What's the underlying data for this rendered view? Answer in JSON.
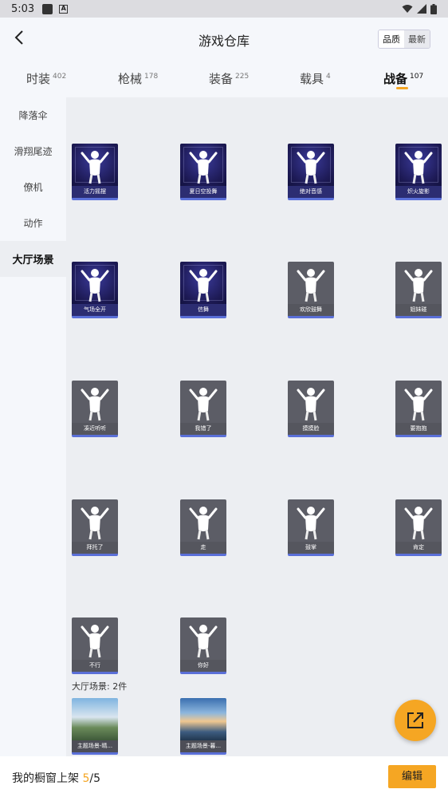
{
  "statusbar": {
    "time": "5:03"
  },
  "header": {
    "title": "游戏仓库",
    "back_icon": "back-arrow-icon",
    "sort": {
      "quality": "品质",
      "newest": "最新",
      "selected": "品质"
    }
  },
  "tabs": [
    {
      "label": "时装",
      "count": "402"
    },
    {
      "label": "枪械",
      "count": "178"
    },
    {
      "label": "装备",
      "count": "225"
    },
    {
      "label": "载具",
      "count": "4"
    },
    {
      "label": "战备",
      "count": "107"
    }
  ],
  "active_tab": "战备",
  "sidebar": {
    "items": [
      {
        "label": "降落伞"
      },
      {
        "label": "滑翔尾迹"
      },
      {
        "label": "僚机"
      },
      {
        "label": "动作"
      },
      {
        "label": "大厅场景"
      }
    ],
    "active": "大厅场景"
  },
  "emotes": [
    {
      "name": "活力摇摆",
      "style": "purple"
    },
    {
      "name": "夏日空投舞",
      "style": "purple"
    },
    {
      "name": "绝对音感",
      "style": "purple"
    },
    {
      "name": "炽火旋影",
      "style": "purple"
    },
    {
      "name": "气场全开",
      "style": "purple"
    },
    {
      "name": "信舞",
      "style": "purple"
    },
    {
      "name": "欢欣鼓舞",
      "style": "gray"
    },
    {
      "name": "姐妹碰",
      "style": "gray"
    },
    {
      "name": "凑近听听",
      "style": "gray"
    },
    {
      "name": "我错了",
      "style": "gray"
    },
    {
      "name": "摸摸脸",
      "style": "gray"
    },
    {
      "name": "要抱抱",
      "style": "gray"
    },
    {
      "name": "拜托了",
      "style": "gray"
    },
    {
      "name": "走",
      "style": "gray"
    },
    {
      "name": "鼓掌",
      "style": "gray"
    },
    {
      "name": "肯定",
      "style": "gray"
    },
    {
      "name": "不行",
      "style": "gray"
    },
    {
      "name": "你好",
      "style": "gray"
    }
  ],
  "scenes": {
    "title": "大厅场景: 2件",
    "items": [
      {
        "name": "主题场景-晴...",
        "style": "scene"
      },
      {
        "name": "主题场景-暮...",
        "style": "scene2"
      }
    ]
  },
  "share_icon": "share-external-icon",
  "bottom": {
    "prefix": "我的橱窗上架 ",
    "current": "5",
    "sep": "/",
    "total": "5",
    "edit_label": "编辑"
  },
  "colors": {
    "accent": "#f5a623",
    "card_bar": "#5a6fd8"
  }
}
